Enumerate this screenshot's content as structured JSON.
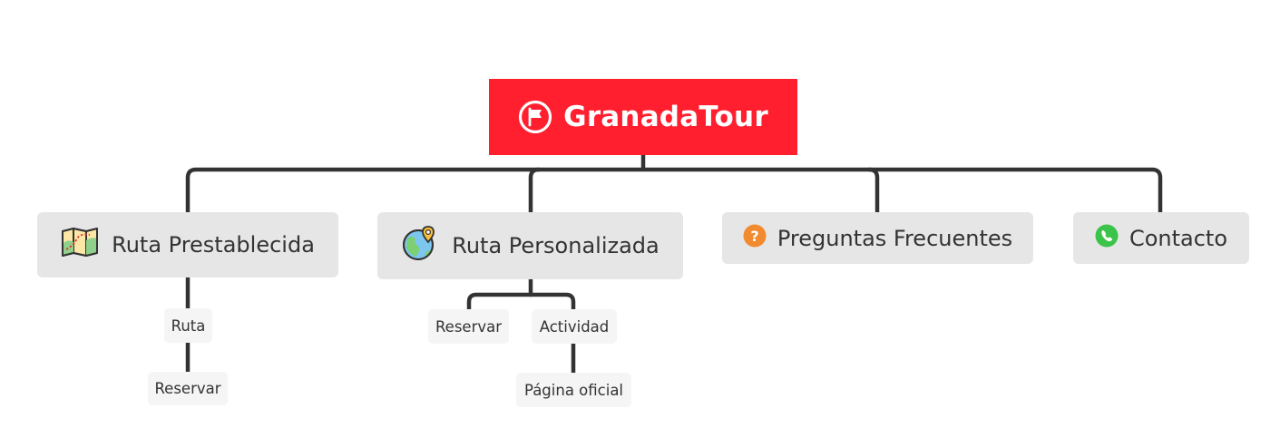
{
  "root": {
    "title": "GranadaTour",
    "icon": "flag-circle-icon",
    "color": "#ff1f2f"
  },
  "branches": {
    "ruta_prestablecida": {
      "label": "Ruta Prestablecida",
      "icon": "map-icon",
      "children": {
        "ruta": "Ruta",
        "reservar": "Reservar"
      }
    },
    "ruta_personalizada": {
      "label": "Ruta Personalizada",
      "icon": "globe-pin-icon",
      "children": {
        "reservar": "Reservar",
        "actividad": "Actividad",
        "pagina_oficial": "Página oficial"
      }
    },
    "preguntas_frecuentes": {
      "label": "Preguntas Frecuentes",
      "icon": "question-icon",
      "icon_color": "#f28a30"
    },
    "contacto": {
      "label": "Contacto",
      "icon": "whatsapp-phone-icon",
      "icon_color": "#3cc34a"
    }
  },
  "colors": {
    "connector": "#333333",
    "main_fill": "#e6e6e6",
    "sub_fill": "#f5f5f5"
  }
}
